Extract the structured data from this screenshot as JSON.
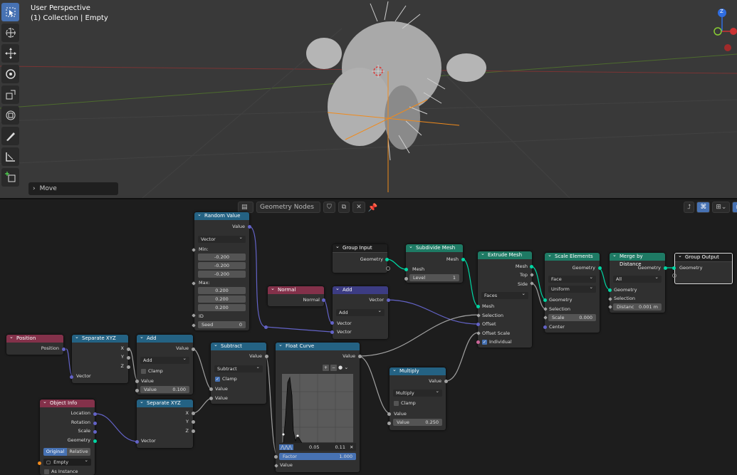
{
  "viewport": {
    "view_name": "User Perspective",
    "collection_info": "(1) Collection | Empty",
    "operator_panel": "Move",
    "gizmo_axis": "Z"
  },
  "editor": {
    "tree_name": "Geometry Nodes"
  },
  "nodes": {
    "random_value": {
      "title": "Random Value",
      "out_value": "Value",
      "type": "Vector",
      "min_label": "Min:",
      "min": [
        "-0.200",
        "-0.200",
        "-0.200"
      ],
      "max_label": "Max:",
      "max": [
        "0.200",
        "0.200",
        "0.200"
      ],
      "id_label": "ID",
      "seed_label": "Seed",
      "seed": "0"
    },
    "group_input": {
      "title": "Group Input",
      "out_geometry": "Geometry"
    },
    "subdivide": {
      "title": "Subdivide Mesh",
      "out_mesh": "Mesh",
      "in_mesh": "Mesh",
      "level_label": "Level",
      "level": "1"
    },
    "extrude": {
      "title": "Extrude Mesh",
      "out_mesh": "Mesh",
      "out_top": "Top",
      "out_side": "Side",
      "mode": "Faces",
      "in_mesh": "Mesh",
      "in_selection": "Selection",
      "in_offset": "Offset",
      "in_offset_scale": "Offset Scale",
      "individual": "Individual"
    },
    "scale_elements": {
      "title": "Scale Elements",
      "out_geometry": "Geometry",
      "domain": "Face",
      "scale_mode": "Uniform",
      "in_geometry": "Geometry",
      "in_selection": "Selection",
      "scale_label": "Scale",
      "scale": "0.000",
      "in_center": "Center"
    },
    "merge": {
      "title": "Merge by Distance",
      "out_geometry": "Geometry",
      "mode": "All",
      "in_geometry": "Geometry",
      "in_selection": "Selection",
      "distance_label": "Distanc",
      "distance": "0.001 m"
    },
    "group_output": {
      "title": "Group Output",
      "in_geometry": "Geometry"
    },
    "normal": {
      "title": "Normal",
      "out_normal": "Normal"
    },
    "vector_add": {
      "title": "Add",
      "out_vector": "Vector",
      "operation": "Add",
      "in_a": "Vector",
      "in_b": "Vector"
    },
    "position": {
      "title": "Position",
      "out_position": "Position"
    },
    "separate_xyz_1": {
      "title": "Separate XYZ",
      "out_x": "X",
      "out_y": "Y",
      "out_z": "Z",
      "in_vector": "Vector"
    },
    "math_add": {
      "title": "Add",
      "out_value": "Value",
      "operation": "Add",
      "clamp": "Clamp",
      "in_value": "Value",
      "value_label": "Value",
      "value": "0.100"
    },
    "subtract": {
      "title": "Subtract",
      "out_value": "Value",
      "operation": "Subtract",
      "clamp": "Clamp",
      "in_value1": "Value",
      "in_value2": "Value"
    },
    "float_curve": {
      "title": "Float Curve",
      "out_value": "Value",
      "pt_x": "0.05",
      "pt_y": "0.11",
      "factor_label": "Factor",
      "factor": "1.000",
      "in_value": "Value"
    },
    "multiply": {
      "title": "Multiply",
      "out_value": "Value",
      "operation": "Multiply",
      "clamp": "Clamp",
      "in_value": "Value",
      "value_label": "Value",
      "value": "0.250"
    },
    "object_info": {
      "title": "Object Info",
      "out_location": "Location",
      "out_rotation": "Rotation",
      "out_scale": "Scale",
      "out_geometry": "Geometry",
      "btn_original": "Original",
      "btn_relative": "Relative",
      "object": "Empty",
      "as_instance": "As Instance"
    },
    "separate_xyz_2": {
      "title": "Separate XYZ",
      "out_x": "X",
      "out_y": "Y",
      "out_z": "Z",
      "in_vector": "Vector"
    }
  },
  "colors": {
    "geometry_socket": "#00d6a3",
    "vector_socket": "#6363c7",
    "float_socket": "#a1a1a1",
    "input_header": "#83314a",
    "converter_header": "#246283",
    "geometry_header": "#1e7a64",
    "vector_header": "#3c3c83",
    "selection_accent": "#4772b3"
  }
}
